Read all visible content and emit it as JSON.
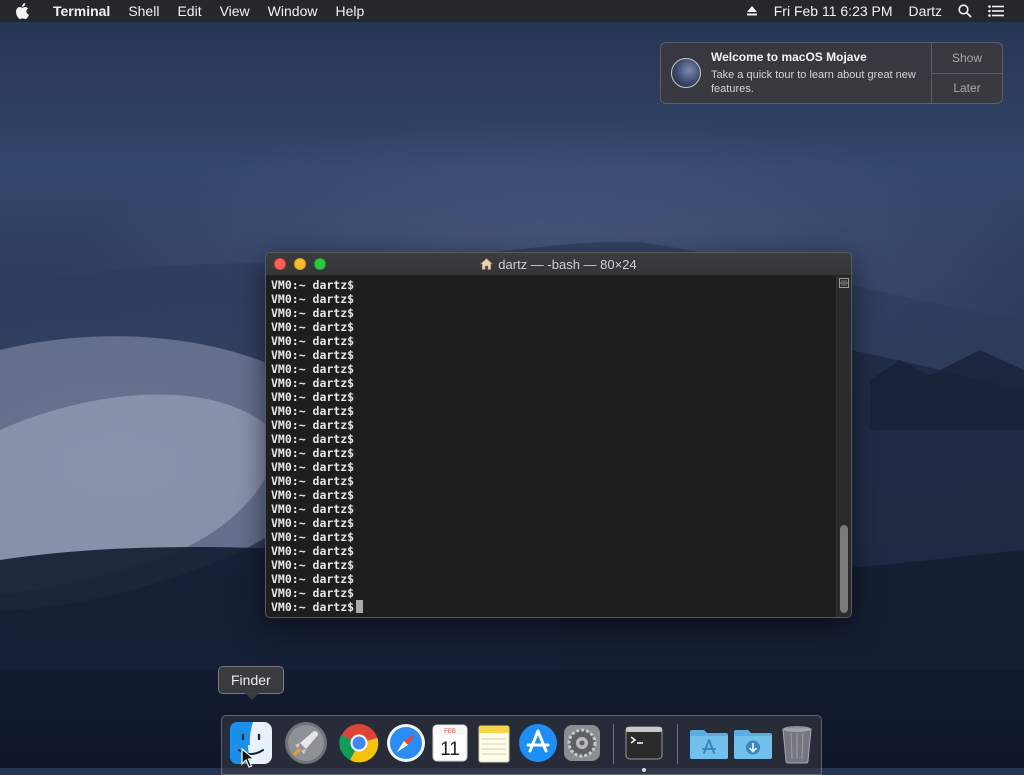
{
  "menubar": {
    "app_name": "Terminal",
    "menus": [
      "Shell",
      "Edit",
      "View",
      "Window",
      "Help"
    ],
    "datetime": "Fri Feb 11  6:23 PM",
    "user": "Dartz"
  },
  "notification": {
    "title": "Welcome to macOS Mojave",
    "body": "Take a quick tour to learn about great new features.",
    "show_label": "Show",
    "later_label": "Later"
  },
  "terminal": {
    "title": "dartz — -bash — 80×24",
    "lines": [
      "VM0:~ dartz$",
      "VM0:~ dartz$",
      "VM0:~ dartz$",
      "VM0:~ dartz$",
      "VM0:~ dartz$",
      "VM0:~ dartz$",
      "VM0:~ dartz$",
      "VM0:~ dartz$",
      "VM0:~ dartz$",
      "VM0:~ dartz$",
      "VM0:~ dartz$",
      "VM0:~ dartz$",
      "VM0:~ dartz$",
      "VM0:~ dartz$",
      "VM0:~ dartz$",
      "VM0:~ dartz$",
      "VM0:~ dartz$",
      "VM0:~ dartz$",
      "VM0:~ dartz$",
      "VM0:~ dartz$",
      "VM0:~ dartz$",
      "VM0:~ dartz$",
      "VM0:~ dartz$"
    ],
    "prompt": "VM0:~ dartz$"
  },
  "tooltip": {
    "label": "Finder"
  },
  "dock": {
    "calendar_month": "FEB",
    "calendar_day": "11",
    "items": [
      "finder-icon",
      "launchpad-icon",
      "chrome-icon",
      "safari-icon",
      "calendar-icon",
      "notes-icon",
      "app-store-icon",
      "system-preferences-icon",
      "terminal-icon",
      "applications-folder-icon",
      "downloads-folder-icon",
      "trash-icon"
    ]
  },
  "colors": {
    "close": "#fd5f57",
    "minimize": "#febc2e",
    "zoom": "#28c840",
    "terminal_bg": "#1e1e1e"
  }
}
